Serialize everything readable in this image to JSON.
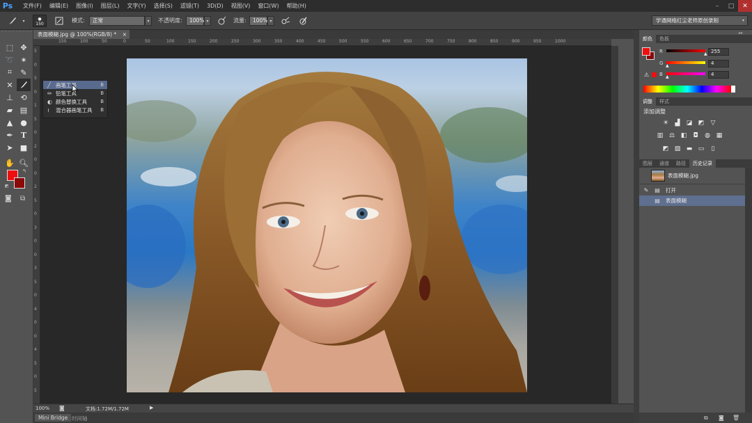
{
  "app": {
    "logo": "Ps"
  },
  "menu": [
    "文件(F)",
    "编辑(E)",
    "图像(I)",
    "图层(L)",
    "文字(Y)",
    "选择(S)",
    "滤镜(T)",
    "3D(D)",
    "视图(V)",
    "窗口(W)",
    "帮助(H)"
  ],
  "window_controls": {
    "minimize": "–",
    "maximize": "□",
    "close": "✕"
  },
  "options": {
    "brush_size": "150",
    "mode_label": "模式:",
    "mode_value": "正常",
    "opacity_label": "不透明度:",
    "opacity_value": "100%",
    "flow_label": "流量:",
    "flow_value": "100%",
    "workspace": "学通网络红尘老师原创录制"
  },
  "document": {
    "tab_title": "表面模糊.jpg @ 100%(RGB/8) *",
    "tab_close": "×",
    "zoom": "100%",
    "doc_info": "文档:1.72M/1.72M"
  },
  "ruler": {
    "h_ticks": [
      "150",
      "100",
      "50",
      "0",
      "50",
      "100",
      "150",
      "200",
      "250",
      "300",
      "350",
      "400",
      "450",
      "500",
      "550",
      "600",
      "650",
      "700",
      "750",
      "800",
      "850",
      "900",
      "950",
      "1000"
    ],
    "v_ticks": [
      "5",
      "0",
      "5",
      "0",
      "1",
      "5",
      "0",
      "2",
      "0",
      "0",
      "2",
      "5",
      "0",
      "3",
      "0",
      "0",
      "3",
      "5",
      "0",
      "4",
      "0",
      "0",
      "4",
      "5",
      "0",
      "5"
    ]
  },
  "flyout": {
    "items": [
      {
        "label": "画笔工具",
        "key": "B",
        "icon": "brush-icon"
      },
      {
        "label": "铅笔工具",
        "key": "B",
        "icon": "pencil-icon"
      },
      {
        "label": "颜色替换工具",
        "key": "B",
        "icon": "color-replace-icon"
      },
      {
        "label": "混合器画笔工具",
        "key": "B",
        "icon": "mixer-brush-icon"
      }
    ]
  },
  "bottom_tabs": {
    "mini_bridge": "Mini Bridge",
    "timeline": "时间轴"
  },
  "color_panel": {
    "tabs": [
      "颜色",
      "色板"
    ],
    "r_label": "R",
    "r_value": "255",
    "g_label": "G",
    "g_value": "4",
    "b_label": "B",
    "b_value": "4",
    "foreground": "#ee1010",
    "background": "#8a0a0a"
  },
  "adjustments_panel": {
    "tabs": [
      "调整",
      "样式"
    ],
    "heading": "添加调整"
  },
  "history_panel": {
    "tabs": [
      "图层",
      "通道",
      "路径",
      "历史记录"
    ],
    "snapshot": "表面模糊.jpg",
    "steps": [
      "打开",
      "表面模糊"
    ]
  }
}
